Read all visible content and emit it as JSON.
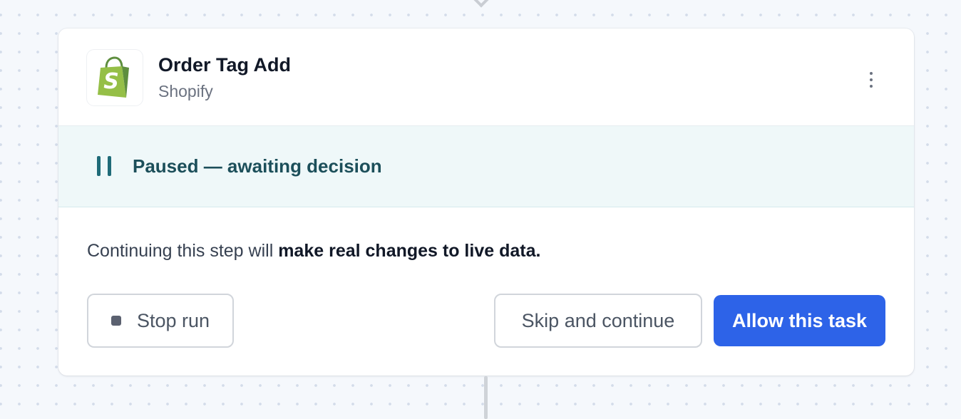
{
  "step": {
    "app_name": "Order Tag Add",
    "app_vendor": "Shopify",
    "logo": "shopify-bag-icon",
    "menu_icon": "vertical-ellipsis-icon"
  },
  "status": {
    "icon": "pause-icon",
    "text": "Paused — awaiting decision"
  },
  "warning": {
    "prefix": "Continuing this step will ",
    "emphasis": "make real changes to live data."
  },
  "actions": {
    "stop_label": "Stop run",
    "stop_icon": "stop-square-icon",
    "skip_label": "Skip and continue",
    "allow_label": "Allow this task"
  },
  "colors": {
    "accent": "#2d63e8",
    "status_text": "#1c4f5a",
    "status_background": "#eff8f9",
    "shopify_green": "#95bf47"
  }
}
